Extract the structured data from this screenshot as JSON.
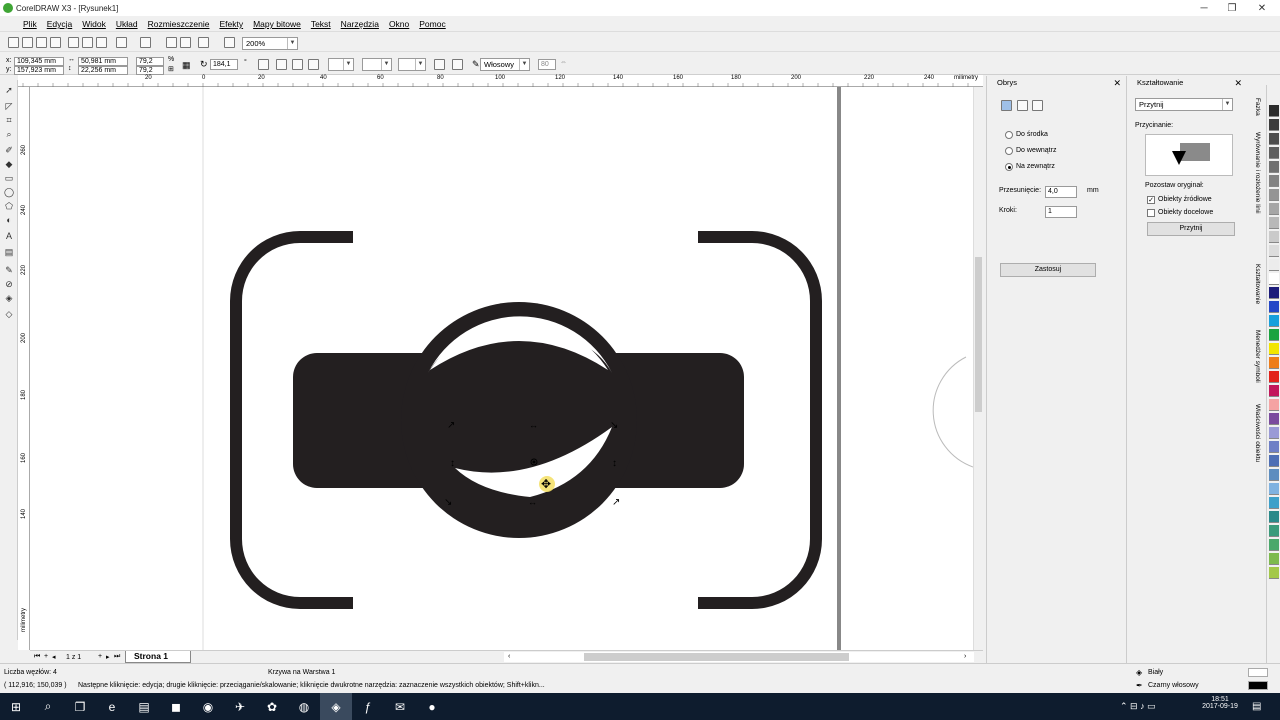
{
  "window": {
    "title": "CorelDRAW X3 - [Rysunek1]"
  },
  "menu": [
    "Plik",
    "Edycja",
    "Widok",
    "Układ",
    "Rozmieszczenie",
    "Efekty",
    "Mapy bitowe",
    "Tekst",
    "Narzędzia",
    "Okno",
    "Pomoc"
  ],
  "toolbar": {
    "zoom": "200%"
  },
  "propbar": {
    "x_label": "x:",
    "x": "109,345 mm",
    "y_label": "y:",
    "y": "157,923 mm",
    "w": "50,981 mm",
    "h": "22,256 mm",
    "scale_x": "79,2",
    "scale_y": "79,2",
    "pct": "%",
    "angle": "184,1",
    "deg": "°",
    "outline_width": "Włosowy",
    "curve_smooth": "80"
  },
  "ruler": {
    "h_ticks": [
      "20",
      "0",
      "20",
      "40",
      "60",
      "80",
      "100",
      "120",
      "140",
      "160",
      "180",
      "200",
      "220",
      "240"
    ],
    "h_unit": "milimetry",
    "v_ticks": [
      "260",
      "240",
      "220",
      "200",
      "180",
      "160",
      "140"
    ],
    "v_unit": "milimetry"
  },
  "page_nav": {
    "counter": "1 z 1",
    "tab": "Strona 1"
  },
  "docker_outline": {
    "title": "Obrys",
    "options": [
      "Do środka",
      "Do wewnątrz",
      "Na zewnątrz"
    ],
    "selected_index": 2,
    "offset_label": "Przesunięcie:",
    "offset": "4,0",
    "offset_unit": "mm",
    "steps_label": "Kroki:",
    "steps": "1",
    "apply": "Zastosuj"
  },
  "docker_shaping": {
    "title": "Kształtowanie",
    "mode": "Przytnij",
    "section": "Przycinanie:",
    "keep_label": "Pozostaw oryginał:",
    "source_objects": "Obiekty źródłowe",
    "source_checked": true,
    "target_objects": "Obiekty docelowe",
    "target_checked": false,
    "button": "Przytnij"
  },
  "side_tabs": [
    "Fazka",
    "Wyrównanie i rozłożenie linii",
    "Kształtowanie",
    "Menedżer symboli",
    "Właściwości obiektu"
  ],
  "palette_colors": [
    "#2b2b2b",
    "#3c3c3c",
    "#4d4d4d",
    "#5e5e5e",
    "#707070",
    "#828282",
    "#949494",
    "#a6a6a6",
    "#b8b8b8",
    "#cacaca",
    "#dcdcdc",
    "#ececec",
    "#ffffff",
    "#1b1b7a",
    "#2447c7",
    "#17a0dc",
    "#1aa33f",
    "#f2e500",
    "#ee7d1a",
    "#e2231a",
    "#c2175b",
    "#f5a3a3",
    "#7b4b9e",
    "#9a9ad6",
    "#6e7fc6",
    "#4e6fb5",
    "#5d8dbf",
    "#7fb2e0",
    "#3da0c9",
    "#2a8a8a",
    "#3a9b7b",
    "#4aa86b",
    "#7dba4e",
    "#a3c84a"
  ],
  "status": {
    "nodes": "Liczba węzłów: 4",
    "object": "Krzywa na Warstwa 1",
    "coords": "( 112,916; 150,039 )",
    "hint": "Następne kliknięcie: edycja; drugie kliknięcie: przeciąganie/skalowanie; kliknięcie dwukrotne narzędzia: zaznaczenie wszystkich obiektów; Shift+klikn...",
    "fill_label": "Biały",
    "outline_label": "Czarny włosowy",
    "fill_color": "#ffffff",
    "outline_color": "#000000"
  },
  "taskbar": {
    "time": "18:51",
    "date": "2017-09-19"
  },
  "colors": {
    "shape": "#231f20",
    "page_border": "#888888"
  }
}
